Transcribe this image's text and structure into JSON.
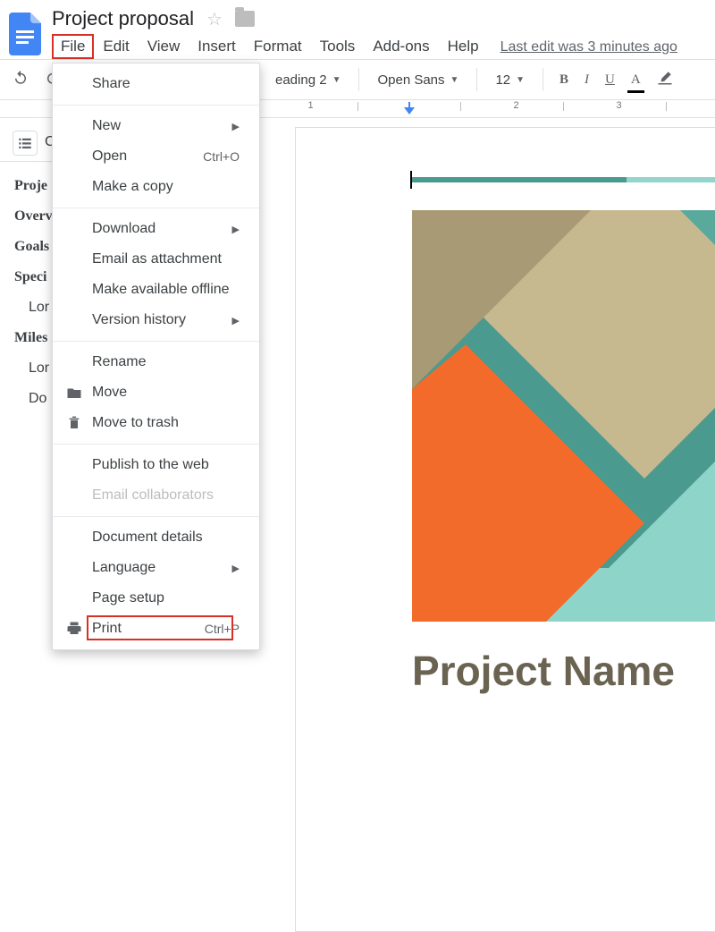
{
  "header": {
    "title": "Project proposal",
    "last_edit": "Last edit was 3 minutes ago"
  },
  "menubar": {
    "file": "File",
    "edit": "Edit",
    "view": "View",
    "insert": "Insert",
    "format": "Format",
    "tools": "Tools",
    "addons": "Add-ons",
    "help": "Help"
  },
  "toolbar": {
    "style": "eading 2",
    "font": "Open Sans",
    "size": "12"
  },
  "ruler": {
    "n1": "1",
    "n2": "2",
    "n3": "3"
  },
  "outline": {
    "label": "C",
    "items": [
      "Proje",
      "Overv",
      "Goals",
      "Speci",
      "Lor",
      "Miles",
      "Lor",
      "Do"
    ]
  },
  "filemenu": {
    "share": "Share",
    "new": "New",
    "open": "Open",
    "open_shortcut": "Ctrl+O",
    "copy": "Make a copy",
    "download": "Download",
    "email_attach": "Email as attachment",
    "offline": "Make available offline",
    "version": "Version history",
    "rename": "Rename",
    "move": "Move",
    "trash": "Move to trash",
    "publish": "Publish to the web",
    "email_collab": "Email collaborators",
    "details": "Document details",
    "language": "Language",
    "page_setup": "Page setup",
    "print": "Print",
    "print_shortcut": "Ctrl+P"
  },
  "document": {
    "heading": "Project Name"
  }
}
